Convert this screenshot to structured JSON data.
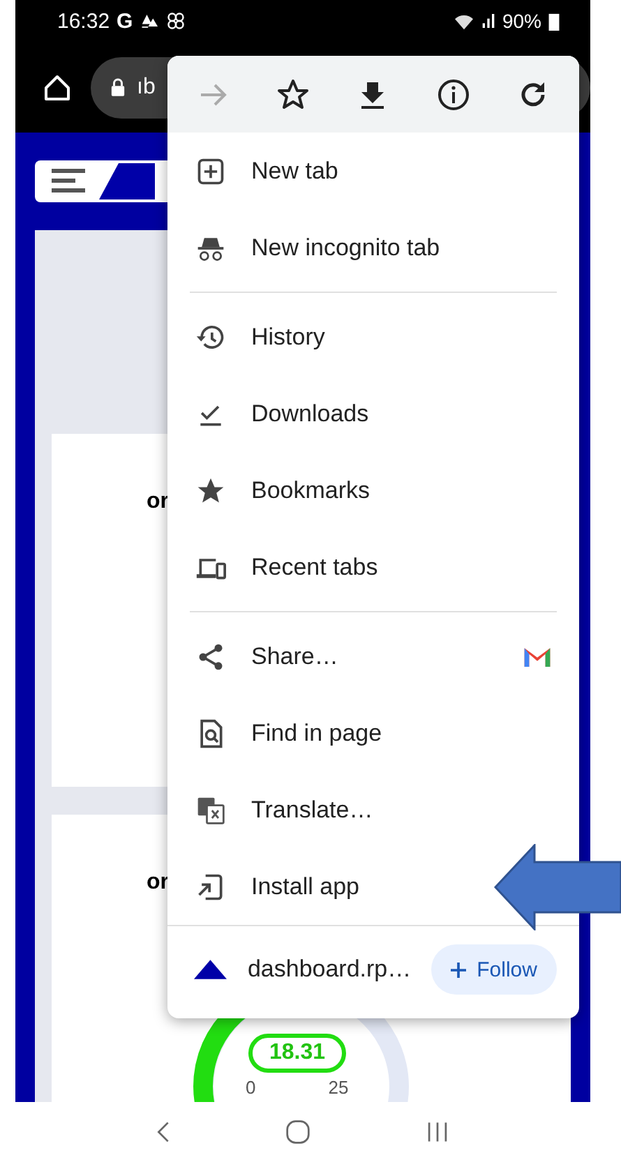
{
  "status_bar": {
    "time": "16:32",
    "app_letter": "G",
    "battery": "90%"
  },
  "address_bar": {
    "url": "ıb"
  },
  "page": {
    "cards": [
      {
        "text": "or"
      },
      {
        "text": "or",
        "gauge": {
          "reading": "18.31",
          "min_label": "0",
          "mid_label": "25"
        }
      }
    ]
  },
  "menu": {
    "actions": [
      {
        "disabled": true
      },
      {
        "disabled": false
      },
      {
        "disabled": false
      },
      {
        "disabled": false
      },
      {
        "disabled": false
      }
    ],
    "groups": [
      [
        {
          "label": "New tab"
        },
        {
          "label": "New incognito tab"
        }
      ],
      [
        {
          "label": "History"
        },
        {
          "label": "Downloads"
        },
        {
          "label": "Bookmarks"
        },
        {
          "label": "Recent tabs"
        }
      ],
      [
        {
          "label": "Share…",
          "kind": "share"
        },
        {
          "label": "Find in page"
        },
        {
          "label": "Translate…"
        },
        {
          "label": "Install app"
        }
      ]
    ],
    "site": {
      "name": "dashboard.rp…",
      "follow": "Follow"
    }
  }
}
